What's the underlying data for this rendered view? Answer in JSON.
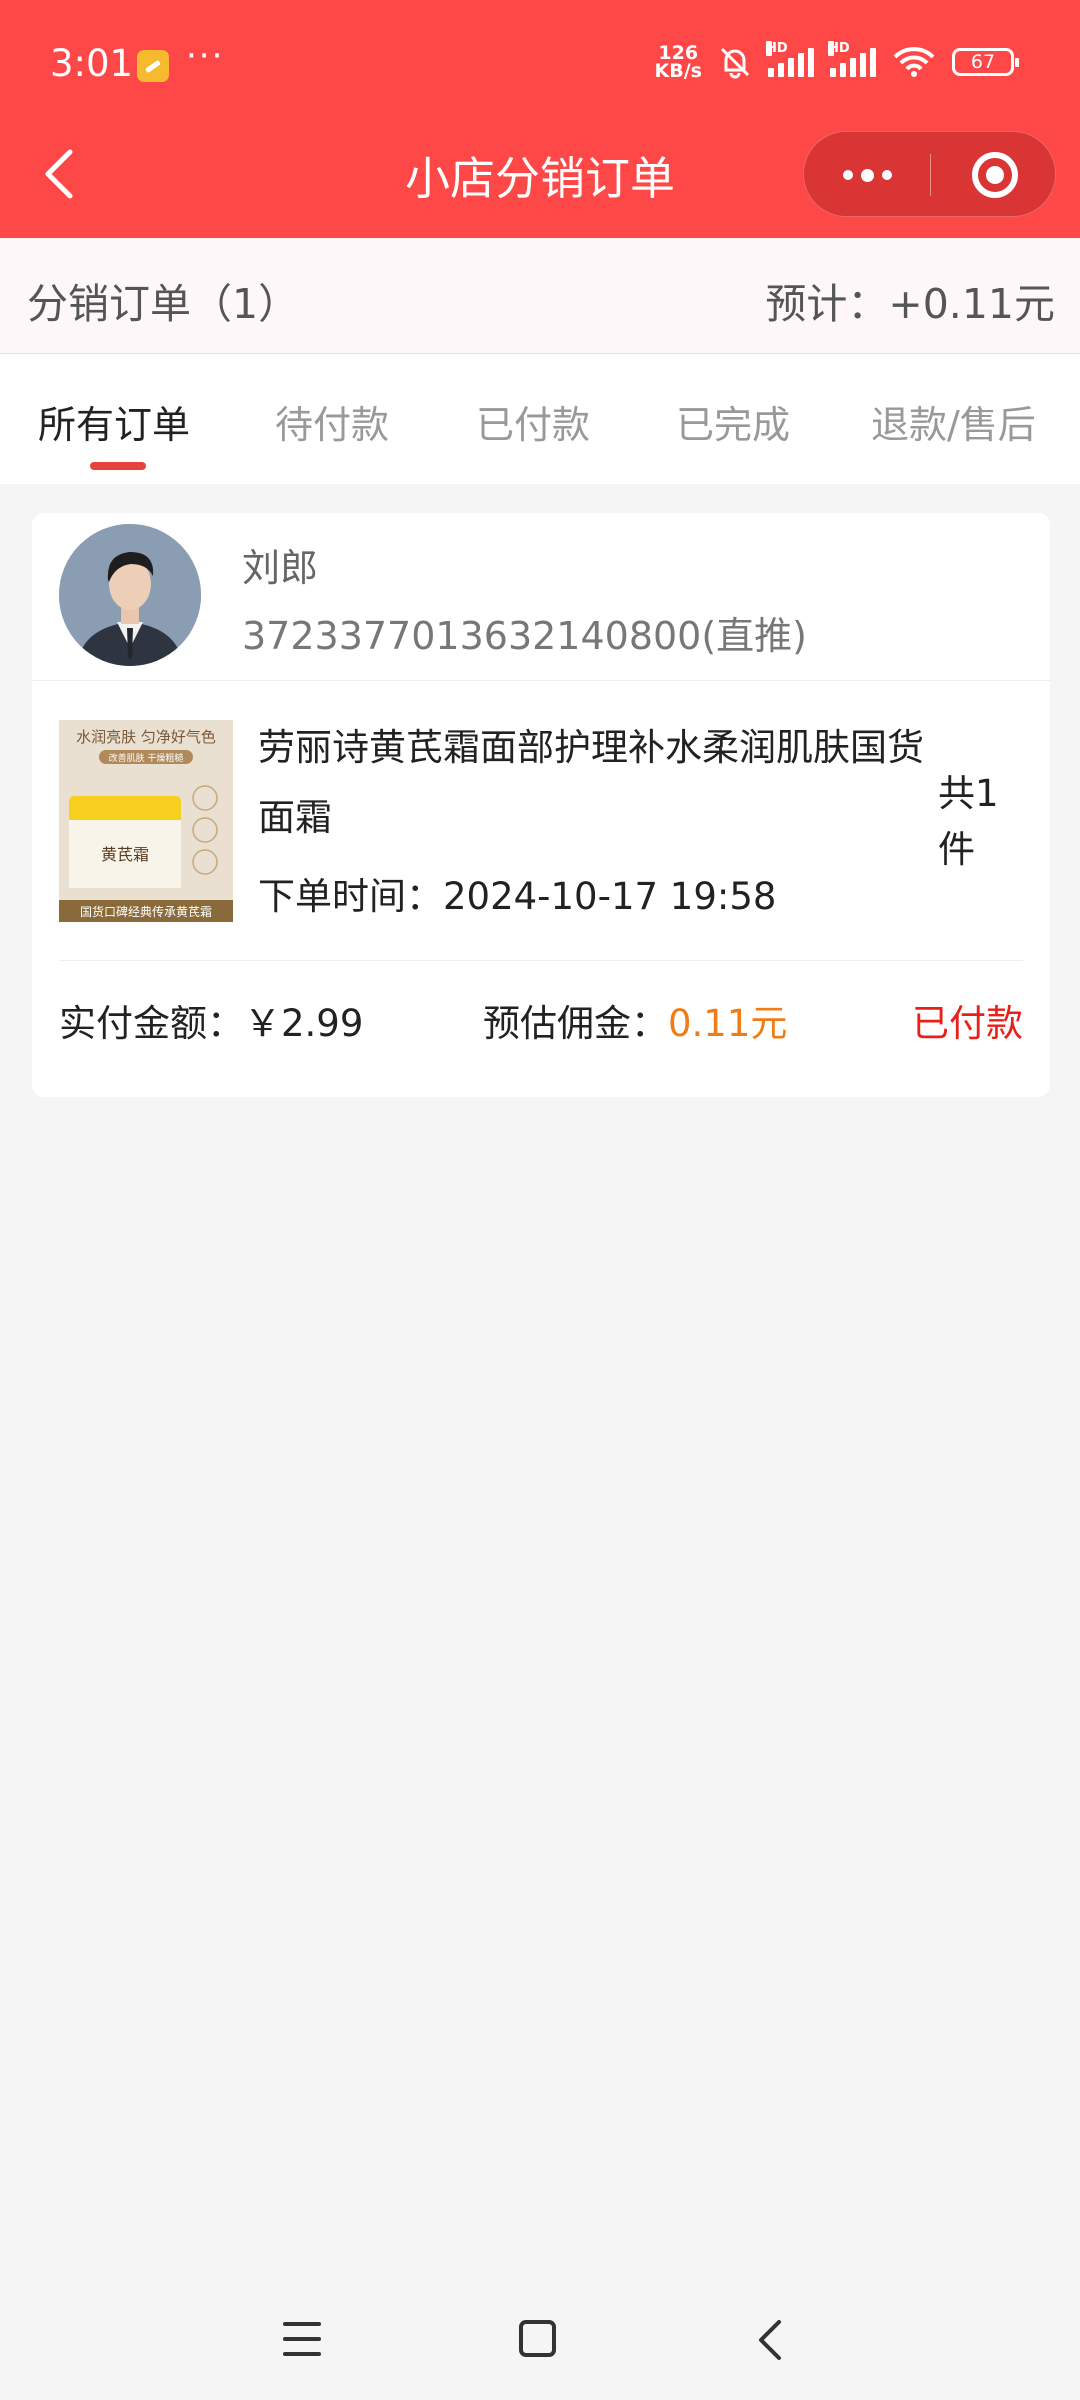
{
  "status_bar": {
    "time": "3:01",
    "more": "···",
    "net_speed_top": "126",
    "net_speed_unit": "KB/s",
    "sig1_label": "HD",
    "sig2_label": "HD",
    "battery": "67"
  },
  "nav": {
    "title": "小店分销订单",
    "back_icon": "chevron-left-icon",
    "more_icon": "more-dots-icon",
    "close_icon": "target-close-icon"
  },
  "summary": {
    "left": "分销订单（1）",
    "right": "预计：+0.11元"
  },
  "tabs": [
    {
      "label": "所有订单",
      "active": true
    },
    {
      "label": "待付款",
      "active": false
    },
    {
      "label": "已付款",
      "active": false
    },
    {
      "label": "已完成",
      "active": false
    },
    {
      "label": "退款/售后",
      "active": false
    }
  ],
  "order": {
    "buyer_name": "刘郎",
    "buyer_id": "3723377013632140800(直推)",
    "product_title": "劳丽诗黄芪霜面部护理补水柔润肌肤国货面霜",
    "quantity": "共1件",
    "order_time": "下单时间：2024-10-17 19:58",
    "paid_label": "实付金额：",
    "paid_value": "￥2.99",
    "commission_label": "预估佣金：",
    "commission_value": "0.11元",
    "status": "已付款",
    "product_image_text": {
      "top": "水润亮肤 匀净好气色",
      "badge": "改善肌肤 干燥粗糙",
      "jar": "黄芪霜",
      "bottom": "国货口碑经典传承黄芪霜"
    }
  },
  "colors": {
    "header_red": "#fe4848",
    "accent_red": "#e8423f",
    "status_red": "#e8201a",
    "commission_orange": "#f07c18"
  }
}
